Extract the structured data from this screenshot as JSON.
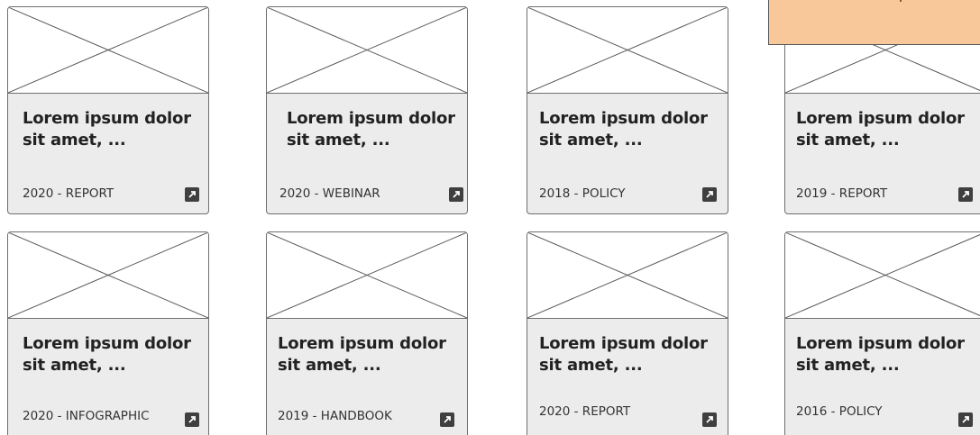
{
  "cards": [
    {
      "title": "Lorem ipsum dolor sit amet, ...",
      "meta": "2020 - REPORT",
      "icon": "external-link-icon"
    },
    {
      "title": "Lorem ipsum dolor sit amet, ...",
      "meta": "2020 - WEBINAR",
      "icon": "external-link-icon"
    },
    {
      "title": "Lorem ipsum dolor sit amet, ...",
      "meta": "2018 - POLICY",
      "icon": "external-link-icon"
    },
    {
      "title": "Lorem ipsum dolor sit amet, ...",
      "meta": "2019 - REPORT",
      "icon": "external-link-icon"
    },
    {
      "title": "Lorem ipsum dolor sit amet, ...",
      "meta": "2020 - INFOGRAPHIC",
      "icon": "external-link-icon"
    },
    {
      "title": "Lorem ipsum dolor sit amet, ...",
      "meta": "2019 - HANDBOOK",
      "icon": "external-link-icon"
    },
    {
      "title": "Lorem ipsum dolor sit amet, ...",
      "meta": "2020 - REPORT",
      "icon": "external-link-icon"
    },
    {
      "title": "Lorem ipsum dolor sit amet, ...",
      "meta": "2016 - POLICY",
      "icon": "external-link-icon"
    }
  ],
  "colors": {
    "card_background": "#ececec",
    "card_border": "#6e6e6e",
    "note_background": "#f9c89a"
  }
}
